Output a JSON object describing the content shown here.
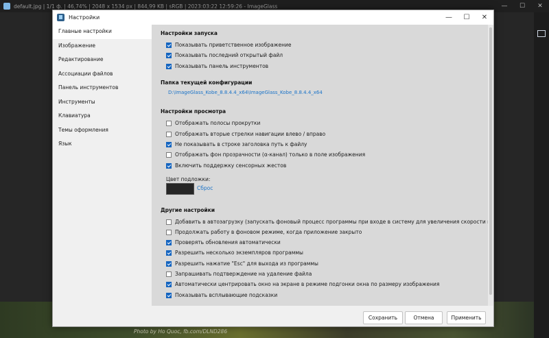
{
  "background_app": {
    "title": "default.jpg  |  1/1 ф.  |  46,74%  |  2048 x 1534 px  |  844,99 KB  |  sRGB  |  2023:03:22 12:59:26  -  ImageGlass",
    "photo_credit": "Photo by Ho Quoc, fb.com/DLND286"
  },
  "dialog": {
    "title": "Настройки",
    "sidebar": {
      "items": [
        {
          "label": "Главные настройки"
        },
        {
          "label": "Изображение"
        },
        {
          "label": "Редактирование"
        },
        {
          "label": "Ассоциации файлов"
        },
        {
          "label": "Панель инструментов"
        },
        {
          "label": "Инструменты"
        },
        {
          "label": "Клавиатура"
        },
        {
          "label": "Темы оформления"
        },
        {
          "label": "Язык"
        }
      ]
    },
    "startup": {
      "title": "Настройки запуска",
      "options": [
        {
          "label": "Показывать приветственное изображение",
          "checked": true
        },
        {
          "label": "Показывать последний открытый файл",
          "checked": true
        },
        {
          "label": "Показывать панель инструментов",
          "checked": true
        }
      ]
    },
    "config_folder": {
      "title": "Папка текущей конфигурации",
      "path": "D:\\ImageGlass_Kobe_8.8.4.4_x64\\ImageGlass_Kobe_8.8.4.4_x64"
    },
    "view": {
      "title": "Настройки просмотра",
      "options": [
        {
          "label": "Отображать полосы прокрутки",
          "checked": false
        },
        {
          "label": "Отображать вторые стрелки навигации влево / вправо",
          "checked": false
        },
        {
          "label": "Не показывать в строке заголовка путь к файлу",
          "checked": true
        },
        {
          "label": "Отображать фон прозрачности (α-канал) только в поле изображения",
          "checked": false
        },
        {
          "label": "Включить поддержку сенсорных жестов",
          "checked": true
        }
      ],
      "backdrop_label": "Цвет подложки:",
      "backdrop_color": "#262626",
      "reset_label": "Сброс"
    },
    "other": {
      "title": "Другие настройки",
      "options": [
        {
          "label": "Добавить в автозагрузку (запускать фоновый процесс программы при входе в систему для увеличения скорости последующих запу",
          "checked": false
        },
        {
          "label": "Продолжать работу в фоновом режиме, когда приложение закрыто",
          "checked": false
        },
        {
          "label": "Проверять обновления автоматически",
          "checked": true
        },
        {
          "label": "Разрешить несколько экземпляров программы",
          "checked": true
        },
        {
          "label": "Разрешить нажатие \"Esc\" для выхода из программы",
          "checked": true
        },
        {
          "label": "Запрашивать подтверждение на удаление файла",
          "checked": false
        },
        {
          "label": "Автоматически центрировать окно на экране в режиме подгонки окна по размеру изображения",
          "checked": true
        },
        {
          "label": "Показывать всплывающие подсказки",
          "checked": true
        }
      ]
    },
    "buttons": {
      "save": "Сохранить",
      "cancel": "Отмена",
      "apply": "Применить"
    }
  }
}
